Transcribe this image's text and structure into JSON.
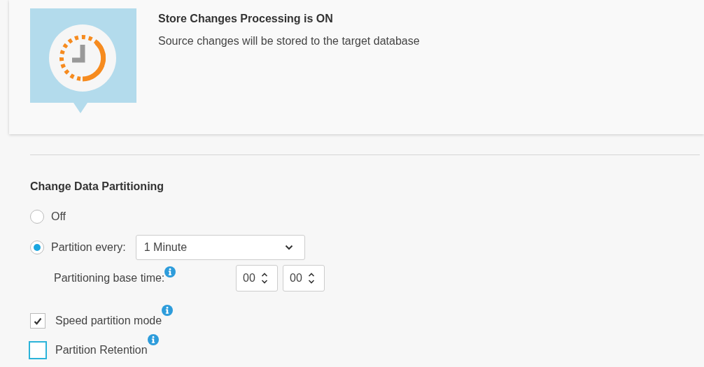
{
  "status_card": {
    "title": "Store Changes Processing is ON",
    "description": "Source changes will be stored to the target database"
  },
  "partitioning": {
    "heading": "Change Data Partitioning",
    "options": [
      {
        "label": "Off",
        "selected": false
      },
      {
        "label": "Partition every:",
        "selected": true
      }
    ],
    "interval": {
      "value": "1 Minute"
    },
    "base_time": {
      "label": "Partitioning base time:",
      "hours": "00",
      "minutes": "00"
    },
    "checkboxes": [
      {
        "label": "Speed partition mode",
        "checked": true,
        "focused": false
      },
      {
        "label": "Partition Retention",
        "checked": false,
        "focused": true
      }
    ]
  }
}
